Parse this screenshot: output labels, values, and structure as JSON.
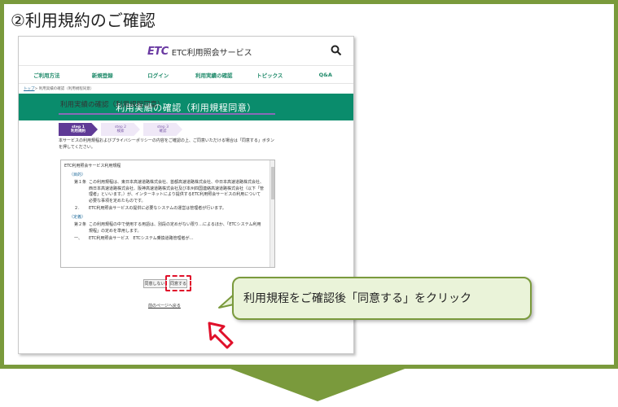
{
  "step_title": "②利用規約のご確認",
  "site": {
    "logo_mark": "ETC",
    "logo_name": "ETC利用照会サービス",
    "nav": [
      "ご利用方法",
      "新規登録",
      "ログイン",
      "利用実績の確認",
      "トピックス",
      "Q&A"
    ],
    "breadcrumb_top": "トップ",
    "breadcrumb_rest": " > 利用実績の確認（利用規程同意）",
    "banner": "利用実績の確認（利用規程同意）",
    "section_title": "利用実績の確認（利用規程同意）",
    "steps": [
      {
        "step": "step 1",
        "label": "利用規約"
      },
      {
        "step": "step 2",
        "label": "検索"
      },
      {
        "step": "step 3",
        "label": "確認"
      }
    ],
    "instruction": "本サービスの利用規程およびプライバシーポリシーの内容をご確認の上、ご同意いただける場合は「同意する」ボタンを押してください。",
    "terms": {
      "heading": "ETC利用照会サービス利用規程",
      "section1": "（目的）",
      "clause1_num": "第１条",
      "clause1_text": "この利用規程は、東日本高速道路株式会社、首都高速道路株式会社、中日本高速道路株式会社、西日本高速道路株式会社、阪神高速道路株式会社及び本州四国連絡高速道路株式会社（以下「管理者」といいます。）が、インターネットにより提供するETC利用照会サービスの利用について必要な事項を定めたものです。",
      "clause1b_num": "２.",
      "clause1b_text": "ETC利用照会サービスの提供に必要なシステムの運営は管理者が行います。",
      "section2": "（定義）",
      "clause2_num": "第２条",
      "clause2_text": "この利用規程の中で使用する用語は、別段の定めがない限り…によるほか、「ETCシステム利用規程」の定めを準用します。",
      "clause2b_num": "一、",
      "clause2b_text": "ETC利用照会サービス　ETCシステム乗換道路管理者が…"
    },
    "btn_disagree": "同意しない",
    "btn_agree": "同意する",
    "back_link": "前のページへ戻る"
  },
  "callout": "利用規程をご確認後「同意する」をクリック",
  "colors": {
    "frame": "#7a9a3c",
    "brand": "#0a8c6c",
    "accent": "#5f3a96",
    "highlight": "#e0102a"
  }
}
